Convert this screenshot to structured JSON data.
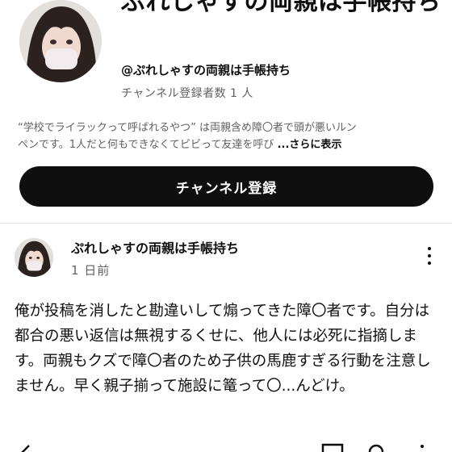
{
  "channel": {
    "title": "ぷれしゃすの両親は手帳持ち",
    "handle": "@ぷれしゃすの両親は手帳持ち",
    "subscribers": "チャンネル登録者数 1 人",
    "description_line1": "“学校でライラックって呼ばれるやつ” は両親含め障〇者で頭が悪いルン",
    "description_line2": "ペンです。1人だと何もできなくてビビって友達を呼び",
    "description_more": "...さらに表示",
    "subscribe_label": "チャンネル登録"
  },
  "post": {
    "author": "ぷれしゃすの両親は手帳持ち",
    "time": "1 日前",
    "body": "俺が投稿を消したと勘違いして煽ってきた障〇者です。自分は都合の悪い返信は無視するくせに、他人には必死に指摘します。両親もクズで障〇者のため子供の馬鹿すぎる行動を注意しません。早く親子揃って施設に篭って〇...んどけ。"
  },
  "icons": {
    "avatar": "profile-photo",
    "more": "more-vert-icon",
    "back": "back-arrow-icon",
    "cast": "cast-icon",
    "search": "search-icon",
    "menu": "more-vert-icon"
  }
}
